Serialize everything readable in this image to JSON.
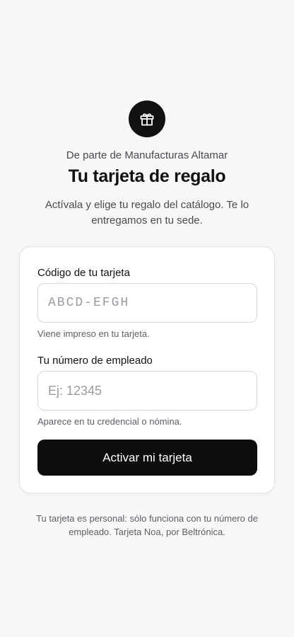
{
  "header": {
    "icon": "gift-icon",
    "from_text": "De parte de Manufacturas Altamar",
    "title": "Tu tarjeta de regalo",
    "subtitle": "Actívala y elige tu regalo del catálogo. Te lo entregamos en tu sede."
  },
  "form": {
    "card_code": {
      "label": "Código de tu tarjeta",
      "placeholder": "ABCD-EFGH",
      "value": "",
      "hint": "Viene impreso en tu tarjeta."
    },
    "employee_number": {
      "label": "Tu número de empleado",
      "placeholder": "Ej: 12345",
      "value": "",
      "hint": "Aparece en tu credencial o nómina."
    },
    "submit_label": "Activar mi tarjeta"
  },
  "footer": {
    "text": "Tu tarjeta es personal: sólo funciona con tu número de empleado. Tarjeta Noa, por Beltrónica."
  },
  "colors": {
    "background": "#f7f7f8",
    "primary": "#0e0e10",
    "card": "#ffffff"
  }
}
